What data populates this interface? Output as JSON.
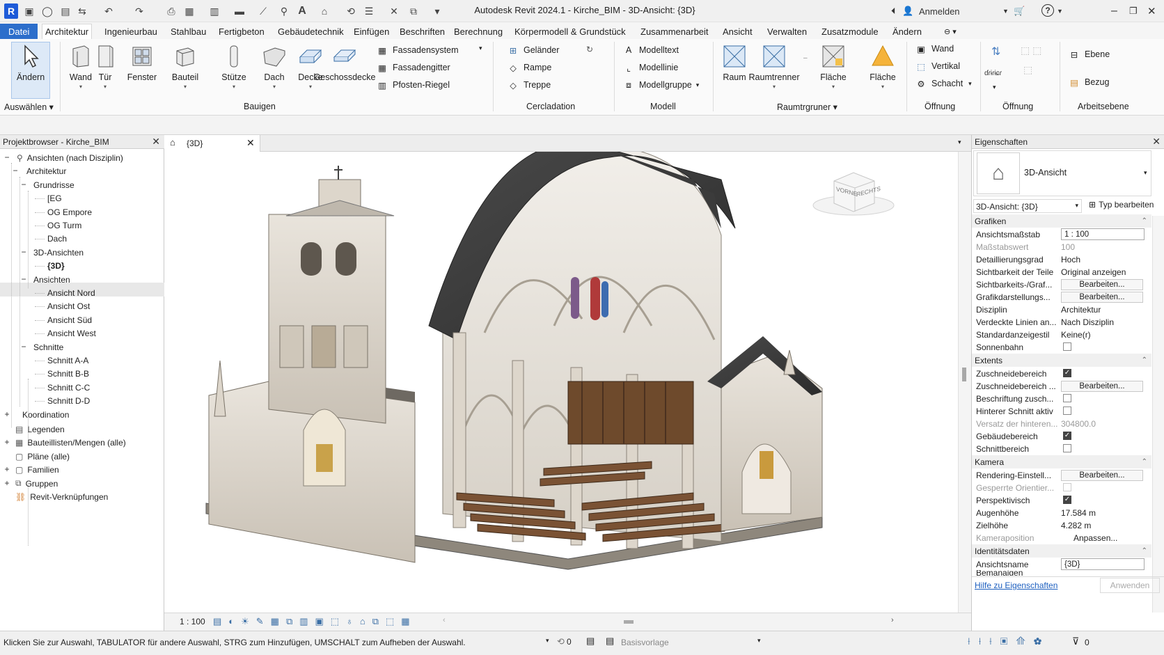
{
  "titlebar": {
    "app_icon": "R",
    "title": "Autodesk Revit 2024.1 - Kirche_BIM - 3D-Ansicht: {3D}",
    "signin": "Anmelden",
    "help": "?"
  },
  "menu": {
    "tabs": [
      "Datei",
      "Architektur",
      "Ingenieurbau",
      "Stahlbau",
      "Fertigbeton",
      "Gebäudetechnik",
      "Einfügen",
      "Beschriften",
      "Berechnung",
      "Körpermodell & Grundstück",
      "Zusammenarbeit",
      "Ansicht",
      "Verwalten",
      "Zusatzmodule",
      "Ändern"
    ]
  },
  "ribbon": {
    "modify": "Ändern",
    "select_panel": "Auswählen",
    "wall": "Wand",
    "door": "Tür",
    "window": "Fenster",
    "component": "Bauteil",
    "column": "Stütze",
    "roof": "Dach",
    "ceiling": "Decke",
    "floor": "Geschossdecke",
    "curtain_system": "Fassadensystem",
    "curtain_grid": "Fassadengitter",
    "mullion": "Pfosten-Riegel",
    "build_panel": "Bauigen",
    "railing": "Geländer",
    "ramp": "Rampe",
    "stair": "Treppe",
    "circulation_panel": "Cercladation",
    "model_text": "Modelltext",
    "model_line": "Modellinie",
    "model_group": "Modellgruppe",
    "model_panel": "Modell",
    "room": "Raum",
    "room_separator": "Raumtrenner",
    "area": "Fläche",
    "area2": "Fläche",
    "room_panel": "Raumtrgruner",
    "op_wall": "Wand",
    "op_vertical": "Vertikal",
    "op_shaft": "Schacht",
    "opening_panel": "Öffnung",
    "opening_panel2": "Öffnung",
    "op_small": "ɗɾɨɾɨɕɾ",
    "level": "Ebene",
    "grid": "Bezug",
    "datum_panel": "Arbeitsebene"
  },
  "browser": {
    "title": "Projektbrowser - Kirche_BIM",
    "items": [
      {
        "label": "Ansichten (nach Disziplin)",
        "tog": "−"
      },
      {
        "label": "Architektur",
        "tog": "−"
      },
      {
        "label": "Grundrisse",
        "tog": "−"
      },
      {
        "label": "[EG",
        "tog": ""
      },
      {
        "label": "OG Empore",
        "tog": ""
      },
      {
        "label": "OG Turm",
        "tog": ""
      },
      {
        "label": "Dach",
        "tog": ""
      },
      {
        "label": "3D-Ansichten",
        "tog": "−"
      },
      {
        "label": "{3D}",
        "tog": ""
      },
      {
        "label": "Ansichten",
        "tog": "−"
      },
      {
        "label": "Ansicht Nord",
        "tog": ""
      },
      {
        "label": "Ansicht Ost",
        "tog": ""
      },
      {
        "label": "Ansicht Süd",
        "tog": ""
      },
      {
        "label": "Ansicht West",
        "tog": ""
      },
      {
        "label": "Schnitte",
        "tog": "−"
      },
      {
        "label": "Schnitt A-A",
        "tog": ""
      },
      {
        "label": "Schnitt B-B",
        "tog": ""
      },
      {
        "label": "Schnitt C-C",
        "tog": ""
      },
      {
        "label": "Schnitt D-D",
        "tog": ""
      },
      {
        "label": "Koordination",
        "tog": "+"
      },
      {
        "label": "Legenden",
        "tog": ""
      },
      {
        "label": "Bauteillisten/Mengen (alle)",
        "tog": "+"
      },
      {
        "label": "Pläne (alle)",
        "tog": ""
      },
      {
        "label": "Familien",
        "tog": "+"
      },
      {
        "label": "Gruppen",
        "tog": "+"
      },
      {
        "label": "Revit-Verknüpfungen",
        "tog": ""
      }
    ]
  },
  "view": {
    "tab_label": "{3D}",
    "viewcube_front": "VORNE",
    "viewcube_right": "RECHTS",
    "scale": "1 : 100"
  },
  "properties": {
    "title": "Eigenschaften",
    "type_name": "3D-Ansicht",
    "instance_selector": "3D-Ansicht: {3D}",
    "edit_type": "Typ bearbeiten",
    "sections": {
      "graphics": "Grafiken",
      "extents": "Extents",
      "camera": "Kamera",
      "identity": "Identitätsdaten"
    },
    "rows": {
      "view_scale": "Ansichtsmaßstab",
      "view_scale_val": "1 : 100",
      "scale_value": "Maßstabswert",
      "scale_value_val": "100",
      "detail_level": "Detaillierungsgrad",
      "detail_level_val": "Hoch",
      "parts_visibility": "Sichtbarkeit der Teile",
      "parts_visibility_val": "Original anzeigen",
      "vg": "Sichtbarkeits-/Graf...",
      "graphic_display": "Grafikdarstellungs...",
      "discipline": "Disziplin",
      "discipline_val": "Architektur",
      "hidden_lines": "Verdeckte Linien an...",
      "hidden_lines_val": "Nach Disziplin",
      "default_template": "Standardanzeigestil",
      "default_template_val": "Keine(r)",
      "sun_path": "Sonnenbahn",
      "crop_view": "Zuschneidebereich",
      "crop_region": "Zuschneidebereich ...",
      "annotation_crop": "Beschriftung zusch...",
      "far_clip": "Hinterer Schnitt aktiv",
      "far_clip_offset": "Versatz der hinteren...",
      "far_clip_offset_val": "304800.0",
      "section_box": "Gebäudebereich",
      "section_box2": "Schnittbereich",
      "render_settings": "Rendering-Einstell...",
      "locked_orientation": "Gesperrte Orientier...",
      "perspective": "Perspektivisch",
      "eye_elevation": "Augenhöhe",
      "eye_elevation_val": "17.584 m",
      "target_elevation": "Zielhöhe",
      "target_elevation_val": "4.282 m",
      "camera_position": "Kameraposition",
      "camera_position_val": "Anpassen...",
      "view_name": "Ansichtsname",
      "view_name_val": "{3D}",
      "dependency": "Bemanaigen"
    },
    "edit_btn": "Bearbeiten...",
    "help_link": "Hilfe zu Eigenschaften",
    "apply": "Anwenden"
  },
  "status": {
    "message": "Klicken Sie zur Auswahl, TABULATOR für andere Auswahl, STRG zum Hinzufügen, UMSCHALT zum Aufheben der Auswahl.",
    "workset_count": "0",
    "design_option": "Basisvorlage",
    "filter_count": "0"
  }
}
